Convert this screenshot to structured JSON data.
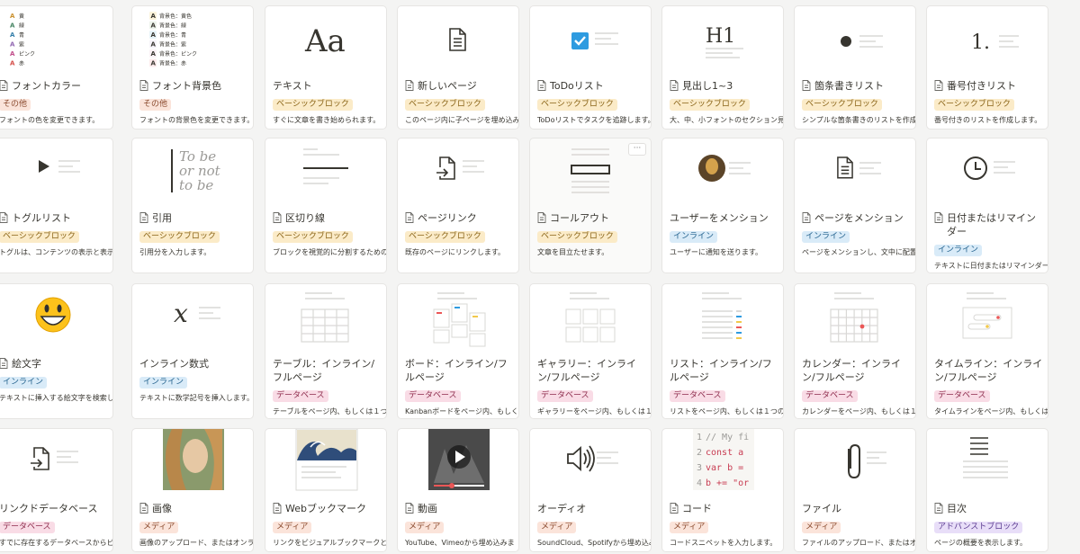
{
  "tag_colors": {
    "その他": {
      "bg": "#fbe4da",
      "fg": "#8a4a2e"
    },
    "ベーシックブロック": {
      "bg": "#fbebc8",
      "fg": "#8a6417"
    },
    "インライン": {
      "bg": "#d9ebf8",
      "fg": "#1f5f8b"
    },
    "データベース": {
      "bg": "#f9dce6",
      "fg": "#8d2b4c"
    },
    "メディア": {
      "bg": "#fbe4da",
      "fg": "#8a4a2e"
    },
    "アドバンストブロック": {
      "bg": "#e8def8",
      "fg": "#5a3a90"
    }
  },
  "color_list": [
    {
      "label": "黄",
      "color": "#cb912f"
    },
    {
      "label": "緑",
      "color": "#448361"
    },
    {
      "label": "青",
      "color": "#337ea9"
    },
    {
      "label": "紫",
      "color": "#9065b0"
    },
    {
      "label": "ピンク",
      "color": "#c14c8a"
    },
    {
      "label": "赤",
      "color": "#d44c47"
    }
  ],
  "bg_color_list": [
    {
      "label": "背景色：黄色",
      "color": "#fbf3db"
    },
    {
      "label": "背景色：緑",
      "color": "#edf3ec"
    },
    {
      "label": "背景色：青",
      "color": "#e7f3f8"
    },
    {
      "label": "背景色：紫",
      "color": "#f6f3f9"
    },
    {
      "label": "背景色：ピンク",
      "color": "#faf1f5"
    },
    {
      "label": "背景色：赤",
      "color": "#fdebec"
    }
  ],
  "preview_text": {
    "aa": "Aa",
    "h1": "H1",
    "numbered": "1.",
    "quote": [
      "To be",
      "or not",
      "to be"
    ],
    "math": "x",
    "code_lines": [
      {
        "n": "1",
        "t": "// My fi"
      },
      {
        "n": "2",
        "t": "const a"
      },
      {
        "n": "3",
        "t": "var b ="
      },
      {
        "n": "4",
        "t": "b += \"or"
      }
    ],
    "more": "···"
  },
  "cards": [
    {
      "id": "font-color",
      "title": "フォントカラー",
      "icon": true,
      "tag": "その他",
      "desc": "フォントの色を変更できます。",
      "preview": "color-list"
    },
    {
      "id": "font-bg",
      "title": "フォント背景色",
      "icon": true,
      "tag": "その他",
      "desc": "フォントの背景色を変更できます。",
      "preview": "bg-list"
    },
    {
      "id": "text",
      "title": "テキスト",
      "icon": false,
      "tag": "ベーシックブロック",
      "desc": "すぐに文章を書き始められます。",
      "preview": "aa"
    },
    {
      "id": "new-page",
      "title": "新しいページ",
      "icon": true,
      "tag": "ベーシックブロック",
      "desc": "このページ内に子ページを埋め込み",
      "preview": "page"
    },
    {
      "id": "todo",
      "title": "ToDoリスト",
      "icon": true,
      "tag": "ベーシックブロック",
      "desc": "ToDoリストでタスクを追跡します。",
      "preview": "todo"
    },
    {
      "id": "heading",
      "title": "見出し1~3",
      "icon": true,
      "tag": "ベーシックブロック",
      "desc": "大、中、小フォントのセクション見",
      "preview": "h1"
    },
    {
      "id": "bullet",
      "title": "箇条書きリスト",
      "icon": true,
      "tag": "ベーシックブロック",
      "desc": "シンプルな箇条書きのリストを作成",
      "preview": "bullet"
    },
    {
      "id": "numbered",
      "title": "番号付きリスト",
      "icon": true,
      "tag": "ベーシックブロック",
      "desc": "番号付きのリストを作成します。",
      "preview": "numbered"
    },
    {
      "id": "toggle",
      "title": "トグルリスト",
      "icon": true,
      "tag": "ベーシックブロック",
      "desc": "トグルは、コンテンツの表示と表示",
      "preview": "toggle"
    },
    {
      "id": "quote",
      "title": "引用",
      "icon": true,
      "tag": "ベーシックブロック",
      "desc": "引用分を入力します。",
      "preview": "quote"
    },
    {
      "id": "divider",
      "title": "区切り線",
      "icon": true,
      "tag": "ベーシックブロック",
      "desc": "ブロックを視覚的に分割するための",
      "preview": "divider"
    },
    {
      "id": "page-link",
      "title": "ページリンク",
      "icon": true,
      "tag": "ベーシックブロック",
      "desc": "既存のページにリンクします。",
      "preview": "pagelink"
    },
    {
      "id": "callout",
      "title": "コールアウト",
      "icon": true,
      "tag": "ベーシックブロック",
      "desc": "文章を目立たせます。",
      "preview": "callout"
    },
    {
      "id": "mention-user",
      "title": "ユーザーをメンション",
      "icon": false,
      "tag": "インライン",
      "desc": "ユーザーに通知を送ります。",
      "preview": "avatar"
    },
    {
      "id": "mention-page",
      "title": "ページをメンション",
      "icon": true,
      "tag": "インライン",
      "desc": "ページをメンションし、文中に配置",
      "preview": "page-lines"
    },
    {
      "id": "date",
      "title": "日付またはリマインダー",
      "icon": true,
      "tag": "インライン",
      "desc": "テキストに日付またはリマインダー",
      "preview": "clock"
    },
    {
      "id": "emoji",
      "title": "絵文字",
      "icon": true,
      "tag": "インライン",
      "desc": "テキストに挿入する絵文字を検索し",
      "preview": "emoji"
    },
    {
      "id": "math",
      "title": "インライン数式",
      "icon": false,
      "tag": "インライン",
      "desc": "テキストに数学記号を挿入します。",
      "preview": "math"
    },
    {
      "id": "table",
      "title": "テーブル：インライン/フルページ",
      "icon": false,
      "tag": "データベース",
      "desc": "テーブルをページ内、もしくは１つ",
      "preview": "table"
    },
    {
      "id": "board",
      "title": "ボード：インライン/フルページ",
      "icon": false,
      "tag": "データベース",
      "desc": "Kanbanボードをページ内、もしくは",
      "preview": "board"
    },
    {
      "id": "gallery",
      "title": "ギャラリー：インライン/フルページ",
      "icon": false,
      "tag": "データベース",
      "desc": "ギャラリーをページ内、もしくは１",
      "preview": "gallery"
    },
    {
      "id": "list",
      "title": "リスト：インライン/フルページ",
      "icon": false,
      "tag": "データベース",
      "desc": "リストをページ内、もしくは１つの",
      "preview": "list"
    },
    {
      "id": "calendar",
      "title": "カレンダー：インライン/フルページ",
      "icon": false,
      "tag": "データベース",
      "desc": "カレンダーをページ内、もしくは１",
      "preview": "calendar"
    },
    {
      "id": "timeline",
      "title": "タイムライン：インライン/フルページ",
      "icon": false,
      "tag": "データベース",
      "desc": "タイムラインをページ内、もしくは",
      "preview": "timeline"
    },
    {
      "id": "linked-db",
      "title": "リンクドデータベース",
      "icon": false,
      "tag": "データベース",
      "desc": "すでに存在するデータベースからビ",
      "preview": "pagelink"
    },
    {
      "id": "image",
      "title": "画像",
      "icon": true,
      "tag": "メディア",
      "desc": "画像のアップロード、またはオンラ",
      "preview": "painting"
    },
    {
      "id": "bookmark",
      "title": "Webブックマーク",
      "icon": true,
      "tag": "メディア",
      "desc": "リンクをビジュアルブックマークと",
      "preview": "wave"
    },
    {
      "id": "video",
      "title": "動画",
      "icon": true,
      "tag": "メディア",
      "desc": "YouTube、Vimeoから埋め込みま",
      "preview": "video"
    },
    {
      "id": "audio",
      "title": "オーディオ",
      "icon": false,
      "tag": "メディア",
      "desc": "SoundCloud、Spotifyから埋め込み",
      "preview": "audio"
    },
    {
      "id": "code",
      "title": "コード",
      "icon": true,
      "tag": "メディア",
      "desc": "コードスニペットを入力します。",
      "preview": "code"
    },
    {
      "id": "file",
      "title": "ファイル",
      "icon": false,
      "tag": "メディア",
      "desc": "ファイルのアップロード、またはオ",
      "preview": "file"
    },
    {
      "id": "toc",
      "title": "目次",
      "icon": true,
      "tag": "アドバンストブロック",
      "desc": "ページの概要を表示します。",
      "preview": "toc"
    }
  ]
}
